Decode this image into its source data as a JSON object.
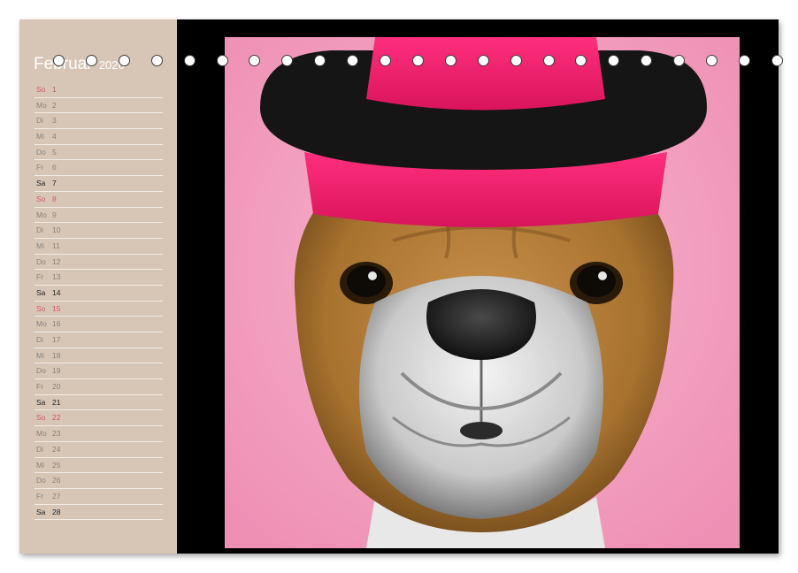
{
  "calendar": {
    "month": "Februar",
    "year": "2026",
    "days": [
      {
        "wd": "So",
        "d": "1",
        "type": "sun"
      },
      {
        "wd": "Mo",
        "d": "2",
        "type": ""
      },
      {
        "wd": "Di",
        "d": "3",
        "type": ""
      },
      {
        "wd": "Mi",
        "d": "4",
        "type": ""
      },
      {
        "wd": "Do",
        "d": "5",
        "type": ""
      },
      {
        "wd": "Fr",
        "d": "6",
        "type": ""
      },
      {
        "wd": "Sa",
        "d": "7",
        "type": "sat"
      },
      {
        "wd": "So",
        "d": "8",
        "type": "sun"
      },
      {
        "wd": "Mo",
        "d": "9",
        "type": ""
      },
      {
        "wd": "Di",
        "d": "10",
        "type": ""
      },
      {
        "wd": "Mi",
        "d": "11",
        "type": ""
      },
      {
        "wd": "Do",
        "d": "12",
        "type": ""
      },
      {
        "wd": "Fr",
        "d": "13",
        "type": ""
      },
      {
        "wd": "Sa",
        "d": "14",
        "type": "sat"
      },
      {
        "wd": "So",
        "d": "15",
        "type": "sun"
      },
      {
        "wd": "Mo",
        "d": "16",
        "type": ""
      },
      {
        "wd": "Di",
        "d": "17",
        "type": ""
      },
      {
        "wd": "Mi",
        "d": "18",
        "type": ""
      },
      {
        "wd": "Do",
        "d": "19",
        "type": ""
      },
      {
        "wd": "Fr",
        "d": "20",
        "type": ""
      },
      {
        "wd": "Sa",
        "d": "21",
        "type": "sat"
      },
      {
        "wd": "So",
        "d": "22",
        "type": "sun"
      },
      {
        "wd": "Mo",
        "d": "23",
        "type": ""
      },
      {
        "wd": "Di",
        "d": "24",
        "type": ""
      },
      {
        "wd": "Mi",
        "d": "25",
        "type": ""
      },
      {
        "wd": "Do",
        "d": "26",
        "type": ""
      },
      {
        "wd": "Fr",
        "d": "27",
        "type": ""
      },
      {
        "wd": "Sa",
        "d": "28",
        "type": "sat"
      }
    ]
  },
  "colors": {
    "sidebar": "#d7c6b6",
    "sunday": "#d9506f",
    "photo_background": "#f6a6c4",
    "frame": "#000000"
  },
  "binding_rings": 23,
  "image": {
    "subject": "bulldog-with-pink-hat"
  }
}
